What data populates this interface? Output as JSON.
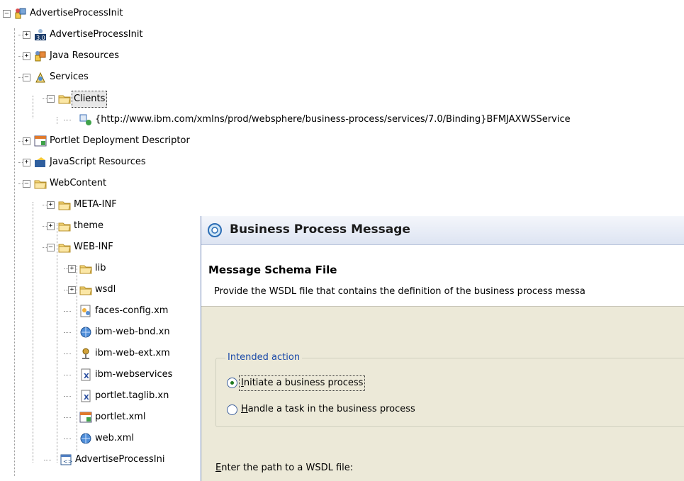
{
  "tree": {
    "nodes": [
      {
        "id": "n0",
        "label": "AdvertiseProcessInit",
        "expander": "−",
        "icon": "project-icon"
      },
      {
        "id": "n1",
        "label": "AdvertiseProcessInit",
        "expander": "+",
        "icon": "version-30-icon"
      },
      {
        "id": "n2",
        "label": "Java Resources",
        "expander": "+",
        "icon": "java-resources-icon"
      },
      {
        "id": "n3",
        "label": "Services",
        "expander": "−",
        "icon": "services-icon"
      },
      {
        "id": "n4",
        "label": "Clients",
        "expander": "−",
        "icon": "folder-icon"
      },
      {
        "id": "n5",
        "label": "{http://www.ibm.com/xmlns/prod/websphere/business-process/services/7.0/Binding}BFMJAXWSService",
        "expander": "",
        "icon": "service-client-icon"
      },
      {
        "id": "n6",
        "label": "Portlet Deployment Descriptor",
        "expander": "+",
        "icon": "portlet-descriptor-icon"
      },
      {
        "id": "n7",
        "label": "JavaScript Resources",
        "expander": "+",
        "icon": "javascript-resources-icon"
      },
      {
        "id": "n8",
        "label": "WebContent",
        "expander": "−",
        "icon": "folder-icon"
      },
      {
        "id": "n9",
        "label": "META-INF",
        "expander": "+",
        "icon": "folder-icon"
      },
      {
        "id": "n10",
        "label": "theme",
        "expander": "+",
        "icon": "folder-icon"
      },
      {
        "id": "n11",
        "label": "WEB-INF",
        "expander": "−",
        "icon": "folder-icon"
      },
      {
        "id": "n12",
        "label": "lib",
        "expander": "+",
        "icon": "folder-icon"
      },
      {
        "id": "n13",
        "label": "wsdl",
        "expander": "+",
        "icon": "folder-icon"
      },
      {
        "id": "n14",
        "label": "faces-config.xm",
        "expander": "",
        "icon": "faces-config-icon"
      },
      {
        "id": "n15",
        "label": "ibm-web-bnd.xn",
        "expander": "",
        "icon": "globe-icon"
      },
      {
        "id": "n16",
        "label": "ibm-web-ext.xm",
        "expander": "",
        "icon": "web-ext-icon"
      },
      {
        "id": "n17",
        "label": "ibm-webservices",
        "expander": "",
        "icon": "xml-file-icon"
      },
      {
        "id": "n18",
        "label": "portlet.taglib.xn",
        "expander": "",
        "icon": "xml-file-icon"
      },
      {
        "id": "n19",
        "label": "portlet.xml",
        "expander": "",
        "icon": "portlet-xml-icon"
      },
      {
        "id": "n20",
        "label": "web.xml",
        "expander": "",
        "icon": "globe-icon"
      },
      {
        "id": "n21",
        "label": "AdvertiseProcessIni",
        "expander": "",
        "icon": "web-app-file-icon"
      }
    ]
  },
  "dialog": {
    "title": "Business Process Message",
    "header_title": "Message Schema File",
    "header_desc": "Provide the WSDL file that contains the definition of the business process messa",
    "group_label": "Intended action",
    "radio1": {
      "mnemonic": "I",
      "rest": "nitiate a business process",
      "selected": true
    },
    "radio2": {
      "mnemonic": "H",
      "rest": "andle a task in the business process",
      "selected": false
    },
    "wsdl_label": {
      "mnemonic": "E",
      "rest": "nter the path to a WSDL file:"
    }
  }
}
